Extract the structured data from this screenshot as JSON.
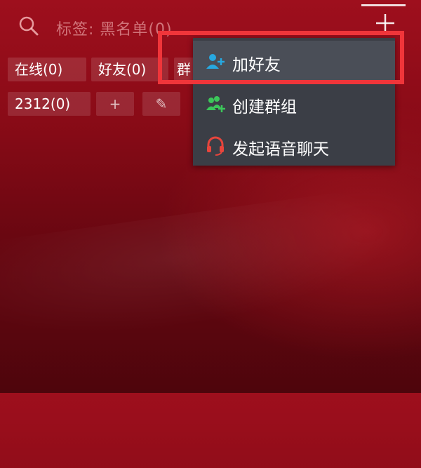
{
  "search": {
    "placeholder_text": "标签: 黑名单(0)",
    "icon": "search-icon"
  },
  "header": {
    "add_icon": "plus-icon"
  },
  "tags": {
    "online": "在线(0)",
    "friends": "好友(0)",
    "partial": "群",
    "custom": "2312(0)",
    "add_tag": "+",
    "edit_tag": "✎"
  },
  "menu": {
    "items": [
      {
        "label": "加好友",
        "icon": "add-friend-icon"
      },
      {
        "label": "创建群组",
        "icon": "create-group-icon"
      },
      {
        "label": "发起语音聊天",
        "icon": "voice-chat-icon"
      }
    ]
  },
  "colors": {
    "highlight": "#f0353a",
    "menu_bg": "#3b3e46",
    "add_friend_icon": "#27a8e0",
    "group_icon": "#3cc65a",
    "voice_icon": "#e8453c"
  }
}
